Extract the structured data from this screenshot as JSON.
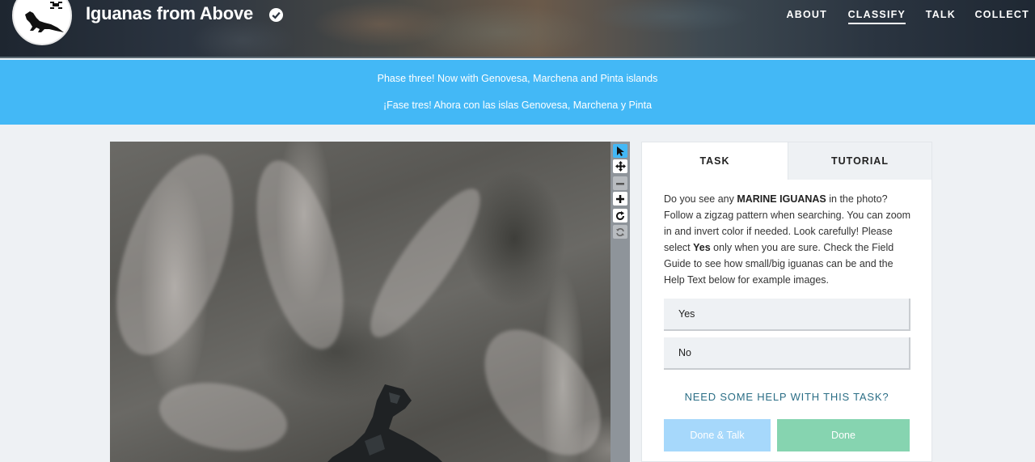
{
  "header": {
    "project_title": "Iguanas from Above",
    "logo_icon": "iguana-drone-logo",
    "verified_icon": "verified-badge-icon",
    "nav": [
      {
        "label": "ABOUT",
        "active": false
      },
      {
        "label": "CLASSIFY",
        "active": true
      },
      {
        "label": "TALK",
        "active": false
      },
      {
        "label": "COLLECT",
        "active": false
      }
    ]
  },
  "banner": {
    "line1": "Phase three! Now with Genovesa, Marchena and Pinta islands",
    "line2": "¡Fase tres! Ahora con las islas Genovesa, Marchena y Pinta",
    "color": "#43b8f6"
  },
  "viewer": {
    "tools": [
      {
        "name": "pointer-icon",
        "state": "active"
      },
      {
        "name": "move-icon",
        "state": "normal"
      },
      {
        "name": "zoom-out-icon",
        "state": "disabled"
      },
      {
        "name": "zoom-in-icon",
        "state": "normal"
      },
      {
        "name": "rotate-icon",
        "state": "normal"
      },
      {
        "name": "reset-icon",
        "state": "disabled"
      }
    ]
  },
  "task": {
    "tabs": {
      "task": "TASK",
      "tutorial": "TUTORIAL"
    },
    "question": {
      "p1": "Do you see any ",
      "strong1": "MARINE IGUANAS",
      "p2": " in the photo? Follow a zigzag pattern when searching. You can zoom in and invert color if needed. Look carefully! Please select ",
      "strong2": "Yes",
      "p3": " only when you are sure. Check the Field Guide to see how small/big iguanas can be and the Help Text below for example images."
    },
    "answers": [
      "Yes",
      "No"
    ],
    "help_link": "NEED SOME HELP WITH THIS TASK?",
    "done_talk_label": "Done & Talk",
    "done_label": "Done"
  }
}
